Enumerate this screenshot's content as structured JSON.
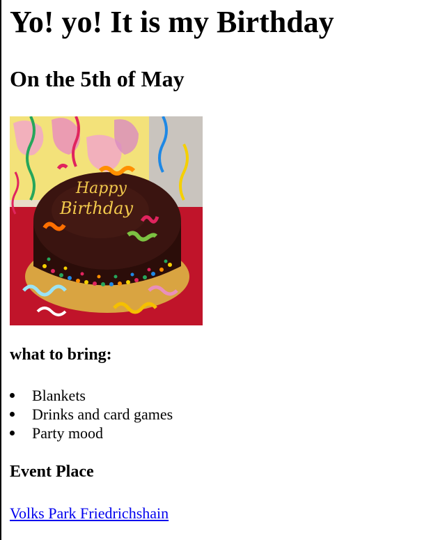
{
  "page": {
    "title": "Yo! yo! It is my Birthday",
    "date_heading": "On the 5th of May",
    "bring_heading": "what to bring:",
    "bring_items": [
      "Blankets",
      "Drinks and card games",
      "Party mood"
    ],
    "place_heading": "Event Place",
    "place_link_text": "Volks Park Friedrichshain"
  },
  "image": {
    "alt": "Happy Birthday cake",
    "cake_text_line1": "Happy",
    "cake_text_line2": "Birthday"
  },
  "colors": {
    "link": "#0000ee",
    "cake_chocolate": "#3a1410",
    "tablecloth": "#c0142a",
    "cake_writing": "#f2c94c"
  }
}
